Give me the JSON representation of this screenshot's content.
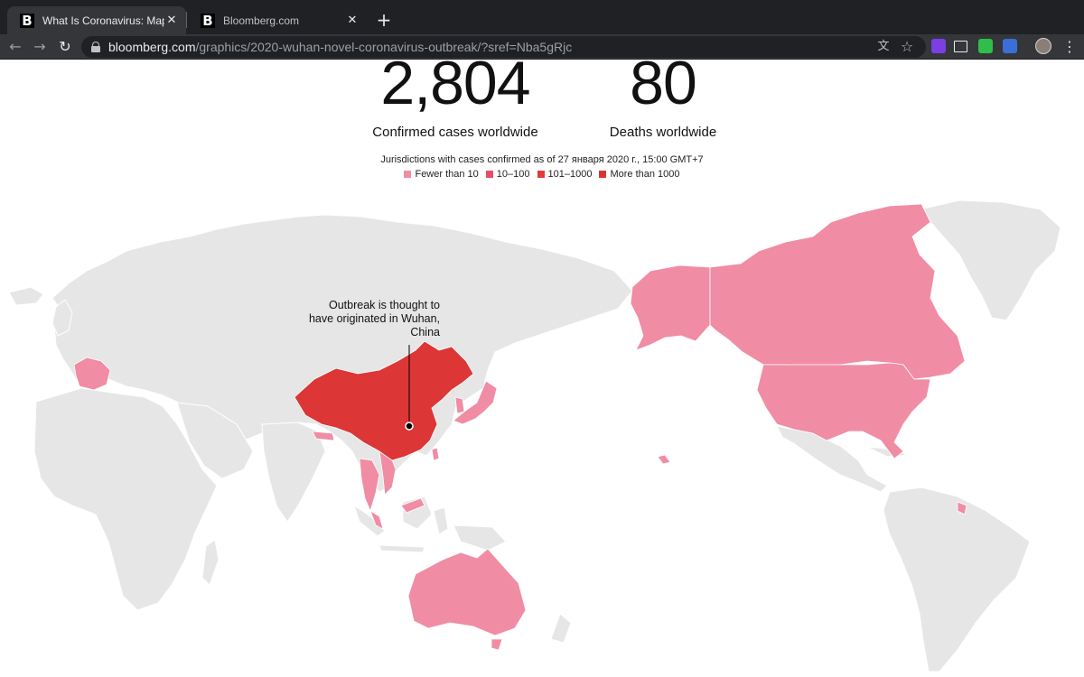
{
  "browser": {
    "tabs": [
      {
        "title": "What Is Coronavirus: Mapping th",
        "favicon": "B",
        "active": true
      },
      {
        "title": "Bloomberg.com",
        "favicon": "B",
        "active": false
      }
    ],
    "close_glyph": "✕",
    "new_tab_glyph": "+",
    "url_host": "bloomberg.com",
    "url_path": "/graphics/2020-wuhan-novel-coronavirus-outbreak/?sref=Nba5gRjc",
    "back_glyph": "←",
    "forward_glyph": "→",
    "reload_glyph": "↻",
    "translate_glyph": "文",
    "star_glyph": "☆",
    "menu_glyph": "⋮"
  },
  "stats": {
    "cases_value": "2,804",
    "cases_label": "Confirmed cases worldwide",
    "deaths_value": "80",
    "deaths_label": "Deaths worldwide"
  },
  "legend": {
    "title": "Jurisdictions with cases confirmed as of 27 января 2020 г., 15:00 GMT+7",
    "items": [
      {
        "label": "Fewer than 10",
        "color": "#f08ca4"
      },
      {
        "label": "10–100",
        "color": "#e44d6e"
      },
      {
        "label": "101–1000",
        "color": "#e23a3a"
      },
      {
        "label": "More than 1000",
        "color": "#d93535"
      }
    ]
  },
  "map": {
    "annotation": [
      "Outbreak is thought to",
      "have originated in Wuhan,",
      "China"
    ],
    "colors": {
      "land": "#e6e6e6",
      "fewer_than_10": "#f08ca4",
      "more_than_1000": "#dd3636",
      "border": "#ffffff"
    }
  }
}
